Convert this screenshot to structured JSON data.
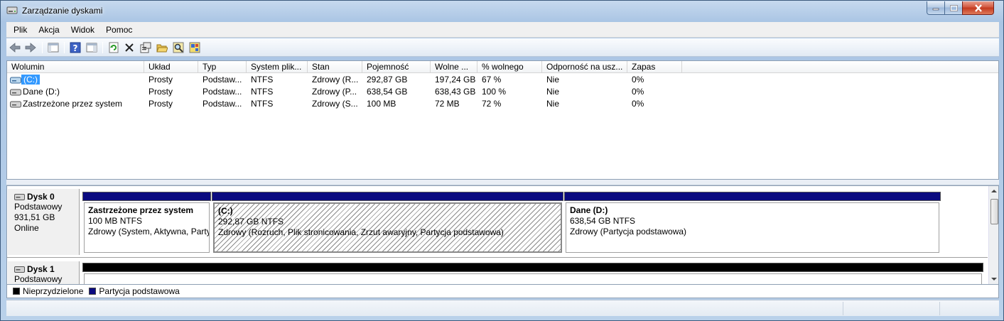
{
  "window": {
    "title": "Zarządzanie dyskami"
  },
  "menu": [
    "Plik",
    "Akcja",
    "Widok",
    "Pomoc"
  ],
  "toolbar": [
    "back-arrow-icon",
    "forward-arrow-icon",
    "show-hide-console-tree-icon",
    "help-icon",
    "properties-pane-icon",
    "refresh-icon",
    "delete-icon",
    "properties-icon",
    "open-folder-icon",
    "explore-search-icon",
    "help-topics-icon"
  ],
  "volume_table": {
    "columns": [
      "Wolumin",
      "Układ",
      "Typ",
      "System plik...",
      "Stan",
      "Pojemność",
      "Wolne ...",
      "% wolnego",
      "Odporność na usz...",
      "Zapas"
    ],
    "rows": [
      {
        "name": "(C:)",
        "layout": "Prosty",
        "type": "Podstaw...",
        "fs": "NTFS",
        "status": "Zdrowy (R...",
        "capacity": "292,87 GB",
        "free": "197,24 GB",
        "pct_free": "67 %",
        "fault": "Nie",
        "overhead": "0%",
        "selected": true
      },
      {
        "name": "Dane (D:)",
        "layout": "Prosty",
        "type": "Podstaw...",
        "fs": "NTFS",
        "status": "Zdrowy (P...",
        "capacity": "638,54 GB",
        "free": "638,43 GB",
        "pct_free": "100 %",
        "fault": "Nie",
        "overhead": "0%",
        "selected": false
      },
      {
        "name": "Zastrzeżone przez system",
        "layout": "Prosty",
        "type": "Podstaw...",
        "fs": "NTFS",
        "status": "Zdrowy (S...",
        "capacity": "100 MB",
        "free": "72 MB",
        "pct_free": "72 %",
        "fault": "Nie",
        "overhead": "0%",
        "selected": false
      }
    ]
  },
  "disks": [
    {
      "title": "Dysk 0",
      "kind": "Podstawowy",
      "size": "931,51 GB",
      "state": "Online",
      "partitions": [
        {
          "name": "Zastrzeżone przez system",
          "size": "100 MB NTFS",
          "status": "Zdrowy (System, Aktywna, Partycja podstawowa)"
        },
        {
          "name": "(C:)",
          "size": "292,87 GB NTFS",
          "status": "Zdrowy (Rozruch, Plik stronicowania, Zrzut awaryjny, Partycja podstawowa)"
        },
        {
          "name": "Dane  (D:)",
          "size": "638,54 GB NTFS",
          "status": "Zdrowy (Partycja podstawowa)"
        }
      ]
    },
    {
      "title": "Dysk 1",
      "kind": "Podstawowy"
    }
  ],
  "legend": [
    {
      "label": "Nieprzydzielone",
      "color": "#000000"
    },
    {
      "label": "Partycja podstawowa",
      "color": "#0a0a80"
    }
  ]
}
